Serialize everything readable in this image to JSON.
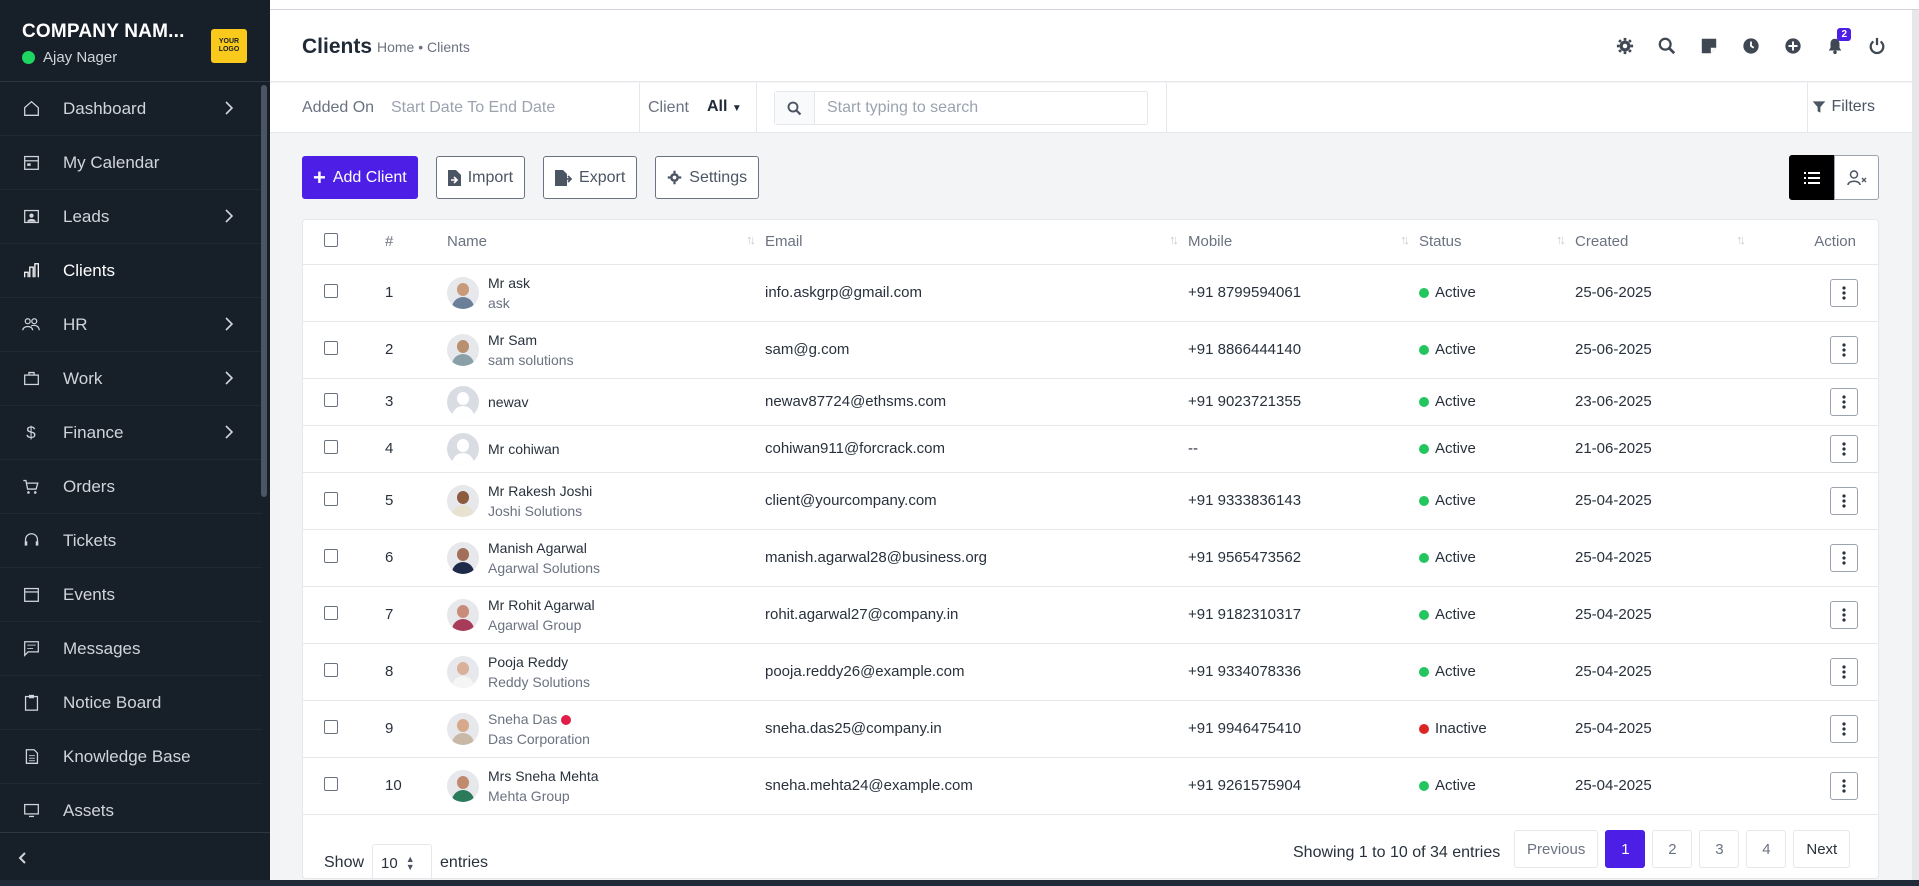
{
  "sidebar": {
    "company": "COMPANY NAM...",
    "user": "Ajay Nager",
    "logo_text": "YOUR LOGO",
    "items": [
      {
        "label": "Dashboard",
        "icon": "home-icon",
        "chevron": true
      },
      {
        "label": "My Calendar",
        "icon": "calendar-icon",
        "chevron": false
      },
      {
        "label": "Leads",
        "icon": "leads-icon",
        "chevron": true
      },
      {
        "label": "Clients",
        "icon": "clients-icon",
        "chevron": false,
        "active": true
      },
      {
        "label": "HR",
        "icon": "hr-icon",
        "chevron": true
      },
      {
        "label": "Work",
        "icon": "briefcase-icon",
        "chevron": true
      },
      {
        "label": "Finance",
        "icon": "dollar-icon",
        "chevron": true
      },
      {
        "label": "Orders",
        "icon": "cart-icon",
        "chevron": false
      },
      {
        "label": "Tickets",
        "icon": "headset-icon",
        "chevron": false
      },
      {
        "label": "Events",
        "icon": "events-icon",
        "chevron": false
      },
      {
        "label": "Messages",
        "icon": "message-icon",
        "chevron": false
      },
      {
        "label": "Notice Board",
        "icon": "clipboard-icon",
        "chevron": false
      },
      {
        "label": "Knowledge Base",
        "icon": "book-icon",
        "chevron": false
      },
      {
        "label": "Assets",
        "icon": "monitor-icon",
        "chevron": false
      }
    ]
  },
  "header": {
    "title": "Clients",
    "breadcrumb": "Home • Clients",
    "notification_count": "2"
  },
  "filters": {
    "added_on_label": "Added On",
    "date_range": "Start Date To End Date",
    "client_label": "Client",
    "client_value": "All",
    "search_placeholder": "Start typing to search",
    "filters_label": "Filters"
  },
  "toolbar": {
    "add_client": "Add Client",
    "import": "Import",
    "export": "Export",
    "settings": "Settings"
  },
  "table": {
    "columns": [
      "#",
      "Name",
      "Email",
      "Mobile",
      "Status",
      "Created",
      "Action"
    ],
    "rows": [
      {
        "num": "1",
        "name": "Mr ask",
        "company": "ask",
        "email": "info.askgrp@gmail.com",
        "mobile": "+91 8799594061",
        "status": "Active",
        "created": "25-06-2025",
        "avatar": "photo",
        "skin": "#c99a7a",
        "shirt": "#6b7f99"
      },
      {
        "num": "2",
        "name": "Mr Sam",
        "company": "sam solutions",
        "email": "sam@g.com",
        "mobile": "+91 8866444140",
        "status": "Active",
        "created": "25-06-2025",
        "avatar": "photo",
        "skin": "#b8906f",
        "shirt": "#8aa0a8"
      },
      {
        "num": "3",
        "name": "newav",
        "company": "",
        "email": "newav87724@ethsms.com",
        "mobile": "+91 9023721355",
        "status": "Active",
        "created": "23-06-2025",
        "avatar": "placeholder"
      },
      {
        "num": "4",
        "name": "Mr cohiwan",
        "company": "",
        "email": "cohiwan911@forcrack.com",
        "mobile": "--",
        "status": "Active",
        "created": "21-06-2025",
        "avatar": "placeholder"
      },
      {
        "num": "5",
        "name": "Mr Rakesh Joshi",
        "company": "Joshi Solutions",
        "email": "client@yourcompany.com",
        "mobile": "+91 9333836143",
        "status": "Active",
        "created": "25-04-2025",
        "avatar": "photo",
        "skin": "#8d5b3e",
        "shirt": "#e8e2d0"
      },
      {
        "num": "6",
        "name": "Manish Agarwal",
        "company": "Agarwal Solutions",
        "email": "manish.agarwal28@business.org",
        "mobile": "+91 9565473562",
        "status": "Active",
        "created": "25-04-2025",
        "avatar": "photo",
        "skin": "#a2705a",
        "shirt": "#1e2a4a"
      },
      {
        "num": "7",
        "name": "Mr Rohit Agarwal",
        "company": "Agarwal Group",
        "email": "rohit.agarwal27@company.in",
        "mobile": "+91 9182310317",
        "status": "Active",
        "created": "25-04-2025",
        "avatar": "photo",
        "skin": "#c98b7a",
        "shirt": "#a83a5a"
      },
      {
        "num": "8",
        "name": "Pooja Reddy",
        "company": "Reddy Solutions",
        "email": "pooja.reddy26@example.com",
        "mobile": "+91 9334078336",
        "status": "Active",
        "created": "25-04-2025",
        "avatar": "photo",
        "skin": "#d9b09a",
        "shirt": "#f5f5f5"
      },
      {
        "num": "9",
        "name": "Sneha Das",
        "company": "Das Corporation",
        "email": "sneha.das25@company.in",
        "mobile": "+91 9946475410",
        "status": "Inactive",
        "created": "25-04-2025",
        "avatar": "photo",
        "skin": "#d7a98a",
        "shirt": "#c9b8a6"
      },
      {
        "num": "10",
        "name": "Mrs Sneha Mehta",
        "company": "Mehta Group",
        "email": "sneha.mehta24@example.com",
        "mobile": "+91 9261575904",
        "status": "Active",
        "created": "25-04-2025",
        "avatar": "photo",
        "skin": "#c08a6e",
        "shirt": "#2b7a5a"
      }
    ]
  },
  "footer": {
    "show_label": "Show",
    "per_page": "10",
    "entries_label": "entries",
    "showing": "Showing 1 to 10 of 34 entries",
    "previous": "Previous",
    "pages": [
      "1",
      "2",
      "3",
      "4"
    ],
    "next": "Next"
  },
  "colors": {
    "accent": "#4c1ee6",
    "active": "#22c55e",
    "inactive": "#dc2626",
    "sidebar_bg": "#171f29"
  }
}
